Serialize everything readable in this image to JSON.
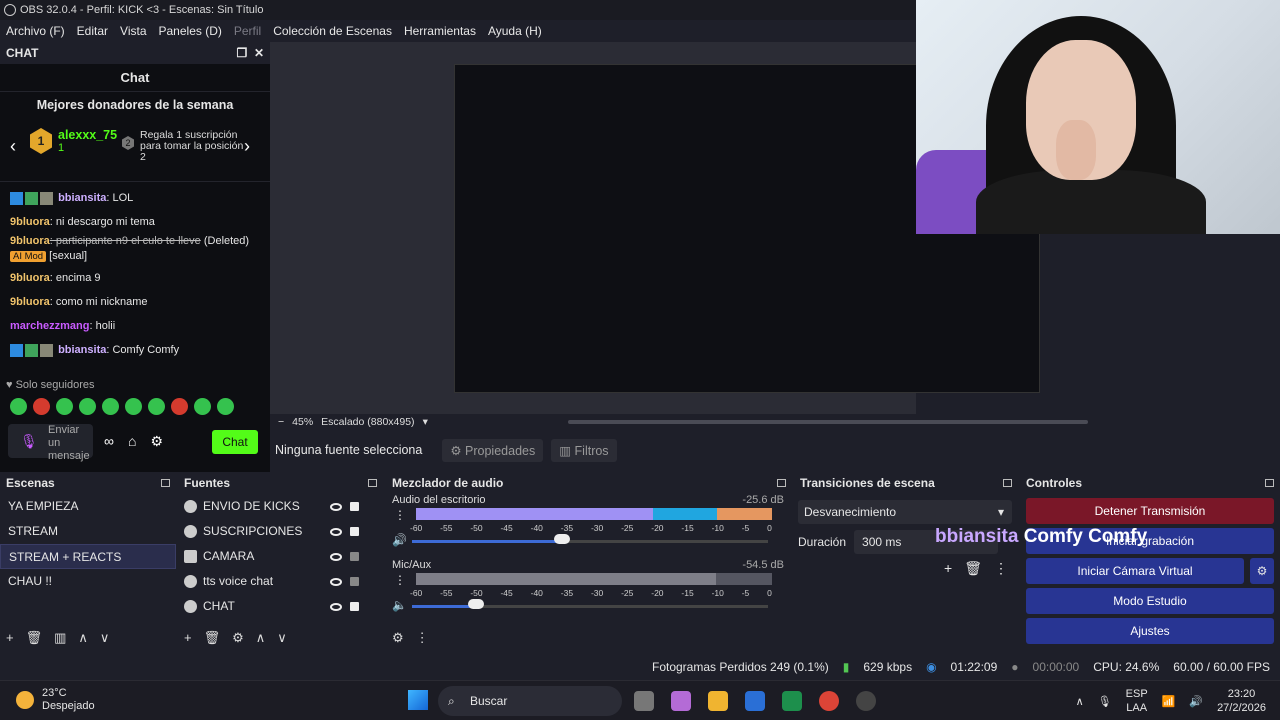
{
  "window": {
    "title": "OBS 32.0.4 - Perfil: KICK <3 - Escenas: Sin Título"
  },
  "menu": [
    "Archivo (F)",
    "Editar",
    "Vista",
    "Paneles (D)",
    "Perfil",
    "Colección de Escenas",
    "Herramientas",
    "Ayuda (H)"
  ],
  "chat": {
    "dock_title": "CHAT",
    "title": "Chat",
    "donors_title": "Mejores donadores de la semana",
    "donor1": {
      "rank": "1",
      "name": "alexxx_75",
      "count": "1"
    },
    "donor2": {
      "rank": "2",
      "text": "Regala 1 suscripción para tomar la posición 2"
    },
    "messages": [
      {
        "user": "bbiansita",
        "text": ": LOL"
      },
      {
        "user": "9bluora",
        "text": ": ni descargo mi tema"
      },
      {
        "user": "9bluora",
        "text": ": participante n9 el culo te lleve",
        "deleted": "(Deleted)",
        "tag": "AI Mod",
        "extra": "[sexual]"
      },
      {
        "user": "9bluora",
        "text": ": encima 9"
      },
      {
        "user": "9bluora",
        "text": ": como mi nickname"
      },
      {
        "user": "marchezzmang",
        "text": ": holii"
      },
      {
        "user": "bbiansita",
        "text": ": Comfy Comfy"
      }
    ],
    "followers_only": "Solo seguidores",
    "input_placeholder": "Enviar un mensaje",
    "send_label": "Chat"
  },
  "zoom": {
    "percent": "45%",
    "scale": "Escalado (880x495)"
  },
  "source_bar": {
    "none_selected": "Ninguna fuente selecciona",
    "properties": "Propiedades",
    "filters": "Filtros"
  },
  "scenes": {
    "title": "Escenas",
    "items": [
      "YA EMPIEZA",
      "STREAM",
      "STREAM + REACTS",
      "CHAU !!"
    ]
  },
  "sources": {
    "title": "Fuentes",
    "items": [
      "ENVIO DE KICKS",
      "SUSCRIPCIONES",
      "CAMARA",
      "tts voice chat",
      "CHAT"
    ]
  },
  "mixer": {
    "title": "Mezclador de audio",
    "scale": [
      "-60",
      "-55",
      "-50",
      "-45",
      "-40",
      "-35",
      "-30",
      "-25",
      "-20",
      "-15",
      "-10",
      "-5",
      "0"
    ],
    "channels": [
      {
        "name": "Audio del escritorio",
        "db": "-25.6 dB",
        "volume": 0.42
      },
      {
        "name": "Mic/Aux",
        "db": "-54.5 dB",
        "volume": 0.18
      }
    ]
  },
  "transitions": {
    "title": "Transiciones de escena",
    "selected": "Desvanecimiento",
    "duration_label": "Duración",
    "duration": "300 ms"
  },
  "overlay": {
    "name": "bbiansita",
    "message": "Comfy Comfy"
  },
  "controls": {
    "title": "Controles",
    "stop": "Detener Transmisión",
    "record": "Iniciar grabación",
    "virtualcam": "Iniciar Cámara Virtual",
    "studio": "Modo Estudio",
    "settings": "Ajustes"
  },
  "status": {
    "frames": "Fotogramas Perdidos 249 (0.1%)",
    "kbps": "629 kbps",
    "stream_time": "01:22:09",
    "rec_time": "00:00:00",
    "cpu": "CPU: 24.6%",
    "fps": "60.00 / 60.00 FPS"
  },
  "taskbar": {
    "temp": "23°C",
    "weather": "Despejado",
    "search": "Buscar",
    "lang1": "ESP",
    "lang2": "LAA",
    "time": "23:20",
    "date": "27/2/2026"
  }
}
